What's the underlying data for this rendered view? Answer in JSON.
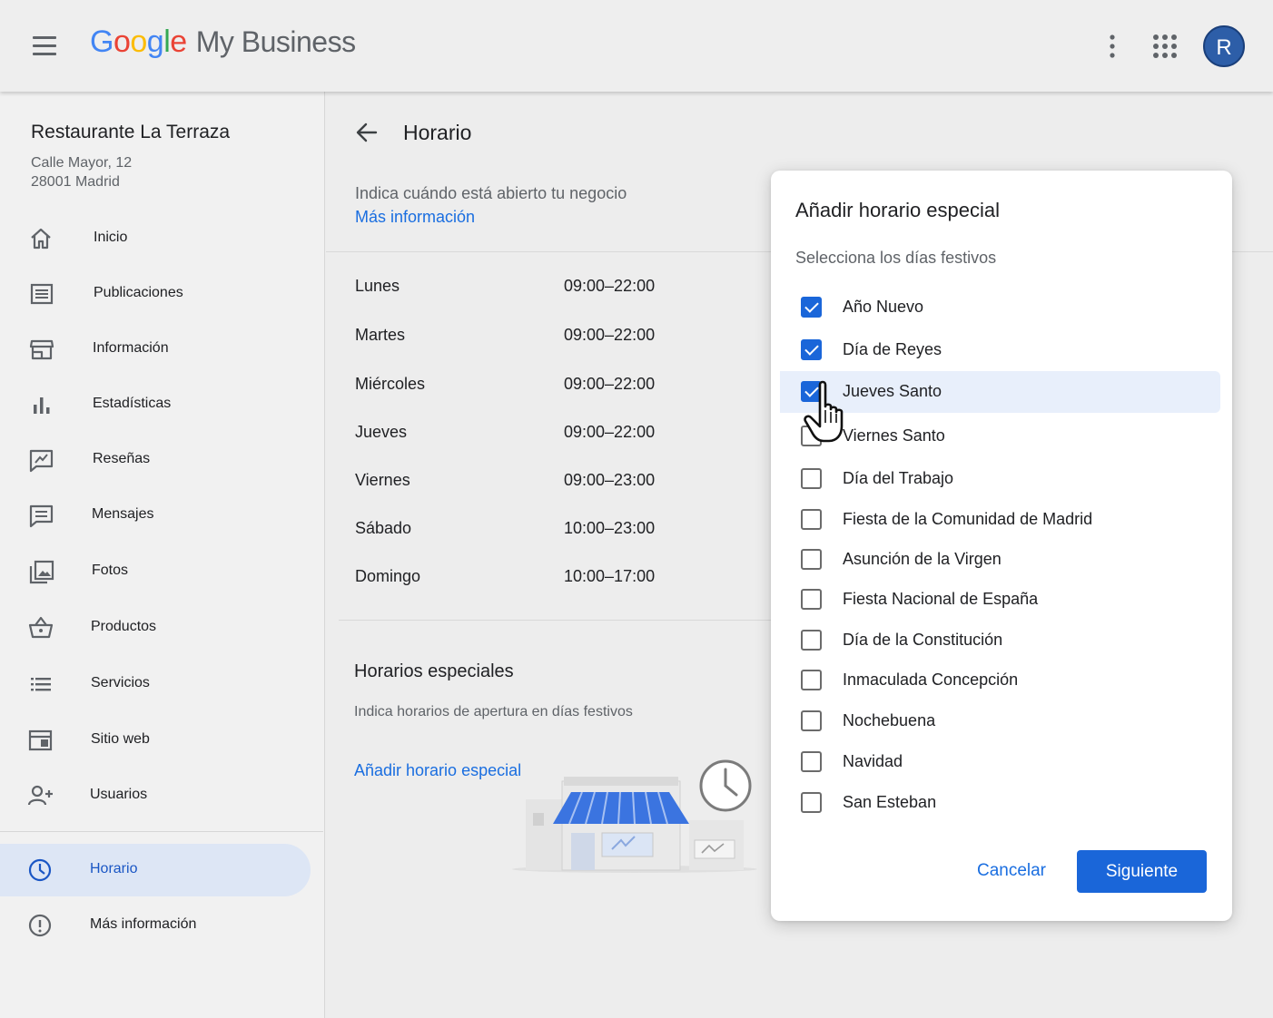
{
  "topbar": {
    "brand_letters": [
      "G",
      "o",
      "o",
      "g",
      "l",
      "e"
    ],
    "product": "My Business",
    "avatar_letter": "R",
    "colors": {
      "brand_blue": "#4285f4",
      "avatar_bg": "#2d5ea8"
    }
  },
  "sidebar": {
    "business_name": "Restaurante La Terraza",
    "address_line1": "Calle Mayor, 12",
    "address_line2": "28001 Madrid",
    "items": [
      {
        "label": "Inicio",
        "icon": "home-icon"
      },
      {
        "label": "Publicaciones",
        "icon": "posts-icon"
      },
      {
        "label": "Información",
        "icon": "storefront-icon"
      },
      {
        "label": "Estadísticas",
        "icon": "bar-chart-icon"
      },
      {
        "label": "Reseñas",
        "icon": "reviews-icon"
      },
      {
        "label": "Mensajes",
        "icon": "message-icon"
      },
      {
        "label": "Fotos",
        "icon": "photos-icon"
      },
      {
        "label": "Productos",
        "icon": "basket-icon"
      },
      {
        "label": "Servicios",
        "icon": "list-icon"
      },
      {
        "label": "Sitio web",
        "icon": "website-icon"
      },
      {
        "label": "Usuarios",
        "icon": "add-user-icon"
      }
    ],
    "bottom_items": [
      {
        "label": "Horario",
        "icon": "clock-icon",
        "active": true
      },
      {
        "label": "Más información",
        "icon": "info-icon",
        "active": false
      }
    ]
  },
  "main": {
    "title": "Horario",
    "description": "Indica cuándo está abierto tu negocio",
    "more_link": "Más información",
    "hours": [
      {
        "day": "Lunes",
        "hours": "09:00–22:00"
      },
      {
        "day": "Martes",
        "hours": "09:00–22:00"
      },
      {
        "day": "Miércoles",
        "hours": "09:00–22:00"
      },
      {
        "day": "Jueves",
        "hours": "09:00–22:00"
      },
      {
        "day": "Viernes",
        "hours": "09:00–23:00"
      },
      {
        "day": "Sábado",
        "hours": "10:00–23:00"
      },
      {
        "day": "Domingo",
        "hours": "10:00–17:00"
      }
    ],
    "special": {
      "title": "Horarios especiales",
      "description": "Indica horarios de apertura en días festivos",
      "link": "Añadir horario especial"
    }
  },
  "dialog": {
    "title": "Añadir horario especial",
    "subtitle": "Selecciona los días festivos",
    "options": [
      {
        "label": "Año Nuevo",
        "checked": true
      },
      {
        "label": "Día de Reyes",
        "checked": true
      },
      {
        "label": "Jueves Santo",
        "checked": true,
        "hover": true
      },
      {
        "label": "Viernes Santo",
        "checked": false
      },
      {
        "label": "Día del Trabajo",
        "checked": false
      },
      {
        "label": "Fiesta de la Comunidad de Madrid",
        "checked": false
      },
      {
        "label": "Asunción de la Virgen",
        "checked": false
      },
      {
        "label": "Fiesta Nacional de España",
        "checked": false
      },
      {
        "label": "Día de la Constitución",
        "checked": false
      },
      {
        "label": "Inmaculada Concepción",
        "checked": false
      },
      {
        "label": "Nochebuena",
        "checked": false
      },
      {
        "label": "Navidad",
        "checked": false
      },
      {
        "label": "San Esteban",
        "checked": false
      }
    ],
    "cancel_label": "Cancelar",
    "next_label": "Siguiente",
    "colors": {
      "primary": "#1a66d9",
      "link": "#1a6ee0"
    }
  }
}
